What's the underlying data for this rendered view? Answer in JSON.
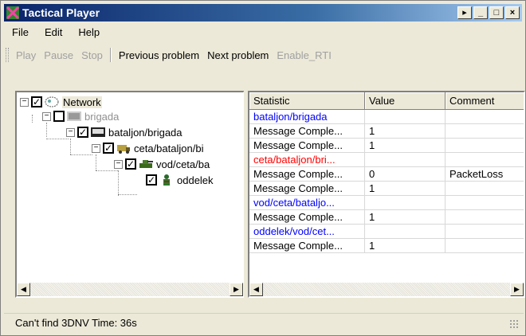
{
  "window": {
    "title": "Tactical Player",
    "btn_help": "▸",
    "btn_min": "_",
    "btn_max": "□",
    "btn_close": "×"
  },
  "menu": [
    "File",
    "Edit",
    "Help"
  ],
  "toolbar": {
    "play": "Play",
    "pause": "Pause",
    "stop": "Stop",
    "previous": "Previous problem",
    "next": "Next problem",
    "enable_rti": "Enable_RTI"
  },
  "tree": [
    {
      "label": "Network",
      "checked": true,
      "expander": "−",
      "icon": "network-cloud-icon"
    },
    {
      "label": "brigada",
      "checked": false,
      "expander": "−",
      "icon": "brigade-flag-icon"
    },
    {
      "label": "bataljon/brigada",
      "checked": true,
      "expander": "−",
      "icon": "battalion-flag-icon"
    },
    {
      "label": "ceta/bataljon/bi",
      "checked": true,
      "expander": "−",
      "icon": "company-truck-icon"
    },
    {
      "label": "vod/ceta/ba",
      "checked": true,
      "expander": "−",
      "icon": "platoon-tank-icon"
    },
    {
      "label": "oddelek",
      "checked": true,
      "expander": "",
      "icon": "squad-soldier-icon"
    }
  ],
  "table": {
    "headers": [
      "Statistic",
      "Value",
      "Comment"
    ],
    "rows": [
      {
        "statistic": "bataljon/brigada",
        "value": "",
        "comment": "",
        "color": "#0000ff"
      },
      {
        "statistic": "Message Comple...",
        "value": "1",
        "comment": "",
        "color": "#000000"
      },
      {
        "statistic": "Message Comple...",
        "value": "1",
        "comment": "",
        "color": "#000000"
      },
      {
        "statistic": "ceta/bataljon/bri...",
        "value": "",
        "comment": "",
        "color": "#ff0000"
      },
      {
        "statistic": "Message Comple...",
        "value": "0",
        "comment": "PacketLoss",
        "color": "#000000"
      },
      {
        "statistic": "Message Comple...",
        "value": "1",
        "comment": "",
        "color": "#000000"
      },
      {
        "statistic": "vod/ceta/bataljo...",
        "value": "",
        "comment": "",
        "color": "#0000ff"
      },
      {
        "statistic": "Message Comple...",
        "value": "1",
        "comment": "",
        "color": "#000000"
      },
      {
        "statistic": "oddelek/vod/cet...",
        "value": "",
        "comment": "",
        "color": "#0000ff"
      },
      {
        "statistic": "Message Comple...",
        "value": "1",
        "comment": "",
        "color": "#000000"
      }
    ]
  },
  "status": {
    "text": "Can't find 3DNV  Time:  36s"
  }
}
